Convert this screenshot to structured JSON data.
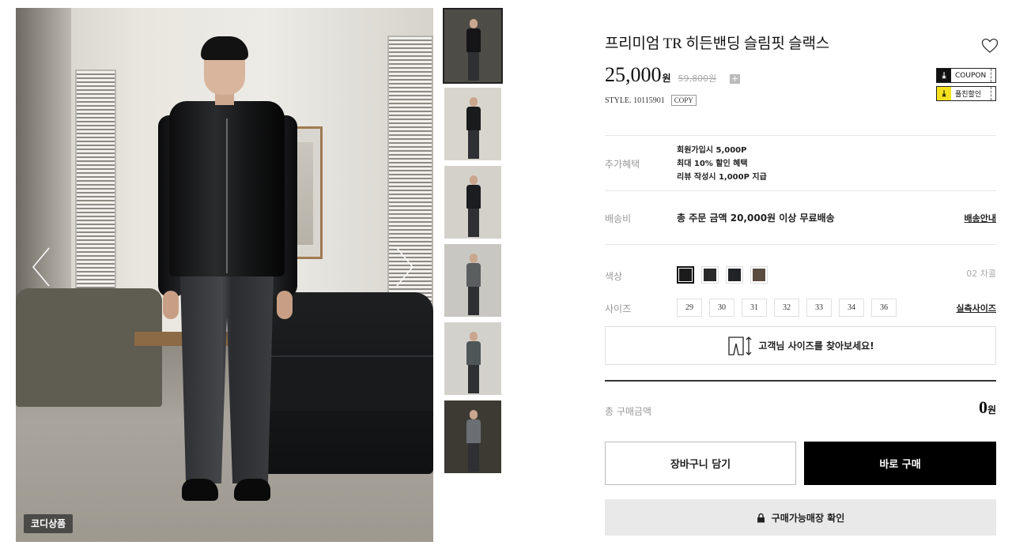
{
  "product": {
    "title": "프리미엄 TR 히든밴딩 슬림핏 슬랙스",
    "price": "25,000",
    "price_unit": "원",
    "original_price": "59,800원",
    "plus_icon": "plus-icon",
    "style_label": "STYLE. 10115901",
    "copy_label": "COPY"
  },
  "coupons": [
    {
      "label": "COUPON",
      "icon": "download-icon",
      "color": "#111111"
    },
    {
      "label": "플친할인",
      "icon": "download-icon",
      "color": "#f4e21e"
    }
  ],
  "main_image": {
    "badge": "코디상품",
    "prev_icon": "chevron-left-icon",
    "next_icon": "chevron-right-icon"
  },
  "thumbnails": [
    {
      "bg": "#4e4c47",
      "top": "#151517",
      "active": true
    },
    {
      "bg": "#d8d5cd",
      "top": "#1a1b1d",
      "active": false
    },
    {
      "bg": "#d4d1ca",
      "top": "#1c1d20",
      "active": false
    },
    {
      "bg": "#c9c7c1",
      "top": "#5b5e5f",
      "active": false
    },
    {
      "bg": "#d3d1cc",
      "top": "#4f5658",
      "active": false
    },
    {
      "bg": "#3d3a34",
      "top": "#6b6f73",
      "active": false
    }
  ],
  "benefit": {
    "label": "추가혜택",
    "line1": "회원가입시 5,000P",
    "line2": "최대 10% 할인 혜택",
    "line3": "리뷰 작성시 1,000P 지급"
  },
  "shipping": {
    "label": "배송비",
    "text": "총 주문 금액 20,000원 이상 무료배송",
    "link": "배송안내"
  },
  "options": {
    "color_label": "색상",
    "color_count": "02 차콜",
    "colors": [
      "#1b1b1b",
      "#2a2a2a",
      "#222326",
      "#5b4c42"
    ],
    "size_label": "사이즈",
    "sizes": [
      "29",
      "30",
      "31",
      "32",
      "33",
      "34",
      "36"
    ],
    "size_link": "실측사이즈",
    "find_size": "고객님 사이즈를 찾아보세요!",
    "find_size_icon": "pants-size-icon"
  },
  "total": {
    "label": "총 구매금액",
    "value": "0",
    "unit": "원"
  },
  "actions": {
    "cart": "장바구니 담기",
    "buy": "바로 구매",
    "store": "구매가능매장 확인",
    "store_icon": "lock-icon",
    "wishlist_icon": "heart-icon"
  }
}
